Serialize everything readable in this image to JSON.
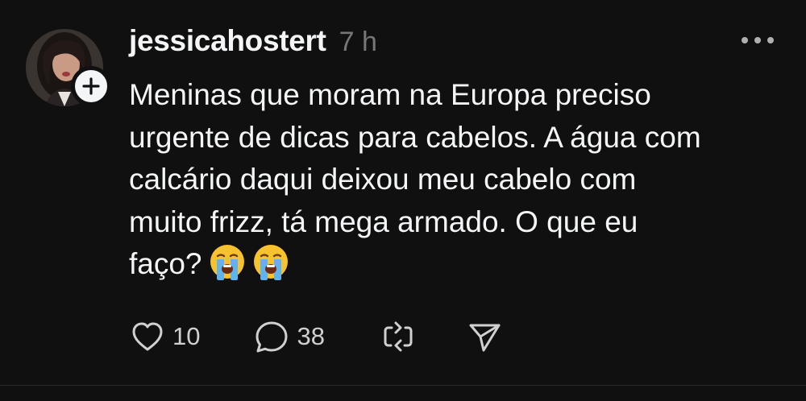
{
  "post": {
    "username": "jessicahostert",
    "time": "7 h",
    "text_lines": [
      "Meninas que moram na Europa preciso",
      "urgente de dicas para cabelos. A água com",
      "calcário daqui deixou meu cabelo com",
      "muito frizz, tá mega armado. O que eu",
      "faço?"
    ],
    "emojis": [
      "loudly-crying-face-emoji",
      "loudly-crying-face-emoji"
    ],
    "likes": "10",
    "replies": "38"
  },
  "colors": {
    "background": "#101010",
    "text": "#f3f5f7",
    "muted": "#777777"
  },
  "icons": {
    "follow": "plus-icon",
    "more": "more-horizontal-icon",
    "like": "heart-icon",
    "reply": "comment-icon",
    "repost": "repost-icon",
    "share": "send-icon"
  }
}
